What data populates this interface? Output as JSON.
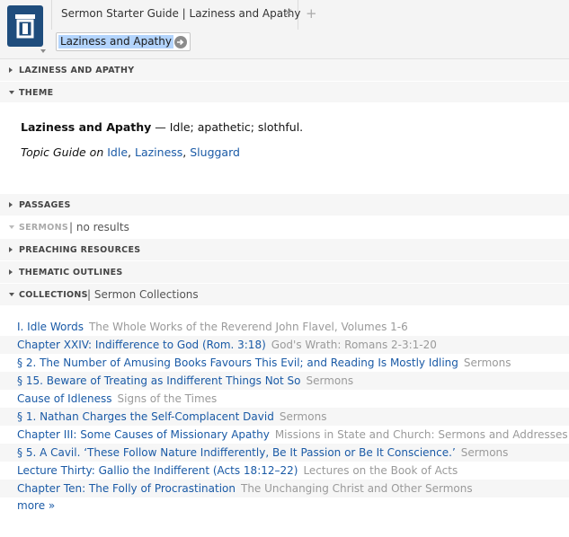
{
  "tab": {
    "title": "Sermon Starter Guide | Laziness and Apathy",
    "close_glyph": "×",
    "add_glyph": "+"
  },
  "search": {
    "value": "Laziness and Apathy"
  },
  "sections": {
    "laziness": {
      "label": "LAZINESS AND APATHY"
    },
    "theme": {
      "label": "THEME"
    },
    "passages": {
      "label": "PASSAGES"
    },
    "sermons": {
      "label": "SERMONS",
      "note": "| no results"
    },
    "preaching": {
      "label": "PREACHING RESOURCES"
    },
    "outlines": {
      "label": "THEMATIC OUTLINES"
    },
    "collections": {
      "label": "COLLECTIONS",
      "note": "|  Sermon Collections"
    }
  },
  "theme": {
    "term": "Laziness and Apathy",
    "dash": " — ",
    "definition": "Idle; apathetic; slothful.",
    "topic_prefix": "Topic Guide on",
    "topics": [
      "Idle",
      "Laziness",
      "Sluggard"
    ]
  },
  "collections": [
    {
      "title": "I. Idle Words",
      "source": "The Whole Works of the Reverend John Flavel, Volumes 1-6"
    },
    {
      "title": "Chapter XXIV: Indifference to God (Rom. 3:18)",
      "source": "God's Wrath: Romans 2-3:1-20"
    },
    {
      "title": "§ 2. The Number of Amusing Books Favours This Evil; and Reading Is Mostly Idling",
      "source": "Sermons"
    },
    {
      "title": "§ 15. Beware of Treating as Indifferent Things Not So",
      "source": "Sermons"
    },
    {
      "title": "Cause of Idleness",
      "source": "Signs of the Times"
    },
    {
      "title": "§ 1. Nathan Charges the Self-Complacent David",
      "source": "Sermons"
    },
    {
      "title": "Chapter III: Some Causes of Missionary Apathy",
      "source": "Missions in State and Church: Sermons and Addresses"
    },
    {
      "title": "§ 5. A Cavil. ‘These Follow Nature Indifferently, Be It Passion or Be It Conscience.’",
      "source": "Sermons"
    },
    {
      "title": "Lecture Thirty: Gallio the Indifferent (Acts 18:12–22)",
      "source": "Lectures on the Book of Acts"
    },
    {
      "title": "Chapter Ten: The Folly of Procrastination",
      "source": "The Unchanging Christ and Other Sermons"
    }
  ],
  "more_label": "more »"
}
